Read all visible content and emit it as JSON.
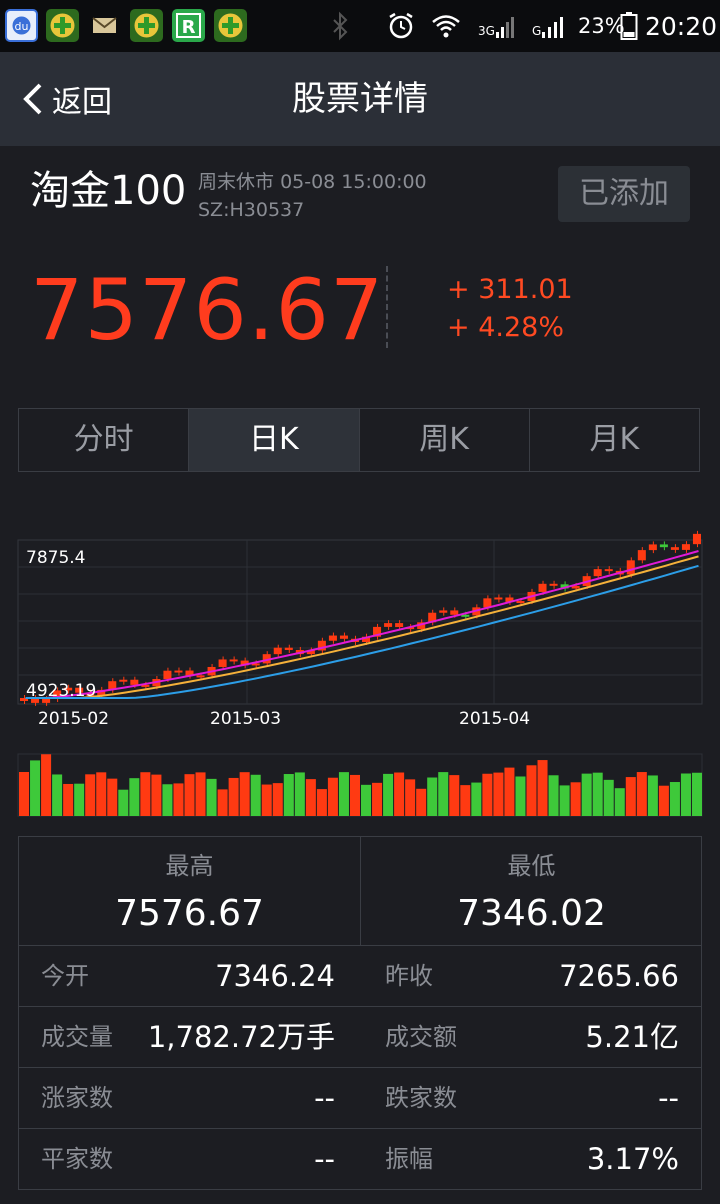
{
  "status_bar": {
    "battery": "23%",
    "time": "20:20",
    "net1": "3G",
    "net2": "G"
  },
  "nav": {
    "back_label": "返回",
    "title": "股票详情"
  },
  "stock": {
    "name": "淘金100",
    "status": "周末休市",
    "datetime": "05-08 15:00:00",
    "code": "SZ:H30537",
    "added_label": "已添加",
    "price": "7576.67",
    "change": "+ 311.01",
    "change_pct": "+ 4.28%"
  },
  "tabs": [
    "分时",
    "日K",
    "周K",
    "月K"
  ],
  "active_tab": "日K",
  "chart_data": {
    "type": "candlestick",
    "ylim": [
      4923.19,
      7875.4
    ],
    "y_labels": [
      "7875.4",
      "4923.19"
    ],
    "x_labels": [
      "2015-02",
      "2015-03",
      "2015-04"
    ],
    "colors": {
      "up": "#ff3a12",
      "down": "#3ec93a",
      "ma5": "#e01ad8",
      "ma10": "#f5b13a",
      "ma20": "#2c9ee8"
    }
  },
  "stats": {
    "high_label": "最高",
    "high": "7576.67",
    "low_label": "最低",
    "low": "7346.02",
    "rows": [
      {
        "l1": "今开",
        "v1": "7346.24",
        "l2": "昨收",
        "v2": "7265.66"
      },
      {
        "l1": "成交量",
        "v1": "1,782.72万手",
        "l2": "成交额",
        "v2": "5.21亿"
      },
      {
        "l1": "涨家数",
        "v1": "--",
        "l2": "跌家数",
        "v2": "--"
      },
      {
        "l1": "平家数",
        "v1": "--",
        "l2": "振幅",
        "v2": "3.17%"
      }
    ]
  }
}
